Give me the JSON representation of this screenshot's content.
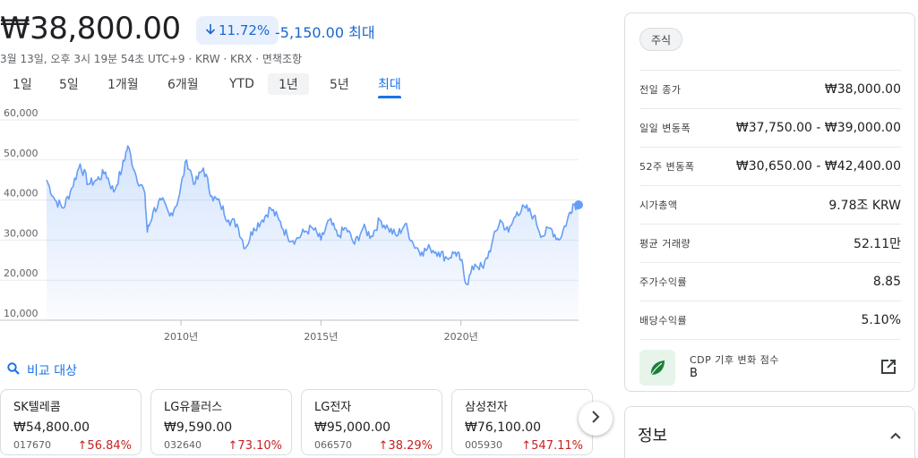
{
  "quote": {
    "price": "₩38,800.00",
    "change_pct": "11.72%",
    "change_abs": "-5,150.00",
    "range_label": "최대",
    "meta": "3월 13일, 오후 3시 19분 54초 UTC+9 · KRW · KRX · 면책조항"
  },
  "tabs": [
    {
      "label": "1일"
    },
    {
      "label": "5일"
    },
    {
      "label": "1개월"
    },
    {
      "label": "6개월"
    },
    {
      "label": "YTD"
    },
    {
      "label": "1년"
    },
    {
      "label": "5년"
    },
    {
      "label": "최대"
    }
  ],
  "selected_tab": "최대",
  "hovered_tab": "1년",
  "colors": {
    "line": "#669df6",
    "negative": "#1967d2",
    "positive": "#c5221f",
    "accent": "#1a73e8"
  },
  "chart_data": {
    "type": "area",
    "x_ticks": [
      2010,
      2015,
      2020
    ],
    "x_tick_labels": [
      "2010년",
      "2015년",
      "2020년"
    ],
    "y_ticks": [
      10000,
      20000,
      30000,
      40000,
      50000,
      60000
    ],
    "y_tick_labels": [
      "10,000",
      "20,000",
      "30,000",
      "40,000",
      "50,000",
      "60,000"
    ],
    "xlim": [
      2005.2,
      2024.2
    ],
    "ylim": [
      10000,
      60000
    ],
    "grid": true,
    "series": [
      {
        "x": [
          2005.2,
          2005.5,
          2005.8,
          2006.1,
          2006.4,
          2006.7,
          2007.0,
          2007.3,
          2007.6,
          2007.9,
          2008.1,
          2008.4,
          2008.7,
          2008.8,
          2009.0,
          2009.3,
          2009.6,
          2009.9,
          2010.2,
          2010.5,
          2010.8,
          2011.1,
          2011.4,
          2011.7,
          2012.0,
          2012.3,
          2012.6,
          2012.9,
          2013.2,
          2013.5,
          2013.8,
          2014.1,
          2014.4,
          2014.7,
          2015.0,
          2015.3,
          2015.6,
          2015.9,
          2016.2,
          2016.5,
          2016.8,
          2017.1,
          2017.4,
          2017.7,
          2018.0,
          2018.3,
          2018.6,
          2018.9,
          2019.2,
          2019.5,
          2019.8,
          2020.0,
          2020.2,
          2020.5,
          2020.8,
          2021.1,
          2021.4,
          2021.7,
          2022.0,
          2022.3,
          2022.6,
          2022.9,
          2023.2,
          2023.5,
          2023.8,
          2024.0,
          2024.2
        ],
        "y": [
          45000,
          40000,
          38000,
          43000,
          49000,
          44000,
          45000,
          47000,
          42000,
          48000,
          53500,
          46000,
          42000,
          32000,
          37000,
          40000,
          36000,
          40000,
          50000,
          44000,
          48000,
          41000,
          39000,
          35000,
          34000,
          28000,
          33000,
          35000,
          38000,
          35000,
          31000,
          30000,
          32000,
          33000,
          30000,
          35000,
          31000,
          33000,
          29000,
          33000,
          31000,
          35000,
          33000,
          31000,
          34000,
          29000,
          27000,
          28000,
          27000,
          25500,
          27000,
          25000,
          19000,
          24000,
          23000,
          29000,
          35000,
          32000,
          37000,
          38000,
          36000,
          31000,
          33000,
          30000,
          35000,
          39000,
          38800
        ]
      }
    ]
  },
  "compare_label": "비교 대상",
  "compare_cards": [
    {
      "name": "SK텔레콤",
      "price": "₩54,800.00",
      "code": "017670",
      "change": "56.84%"
    },
    {
      "name": "LG유플러스",
      "price": "₩9,590.00",
      "code": "032640",
      "change": "73.10%"
    },
    {
      "name": "LG전자",
      "price": "₩95,000.00",
      "code": "066570",
      "change": "38.29%"
    },
    {
      "name": "삼성전자",
      "price": "₩76,100.00",
      "code": "005930",
      "change": "547.11%"
    }
  ],
  "panel": {
    "chip": "주식",
    "stats": [
      {
        "label": "전일 종가",
        "value": "₩38,000.00"
      },
      {
        "label": "일일 변동폭",
        "value": "₩37,750.00 - ₩39,000.00"
      },
      {
        "label": "52주 변동폭",
        "value": "₩30,650.00 - ₩42,400.00"
      },
      {
        "label": "시가총액",
        "value": "9.78조 KRW"
      },
      {
        "label": "평균 거래량",
        "value": "52.11만"
      },
      {
        "label": "주가수익률",
        "value": "8.85"
      },
      {
        "label": "배당수익률",
        "value": "5.10%"
      }
    ],
    "cdp_label": "CDP 기후 변화 점수",
    "cdp_value": "B"
  },
  "info": {
    "title": "정보"
  }
}
